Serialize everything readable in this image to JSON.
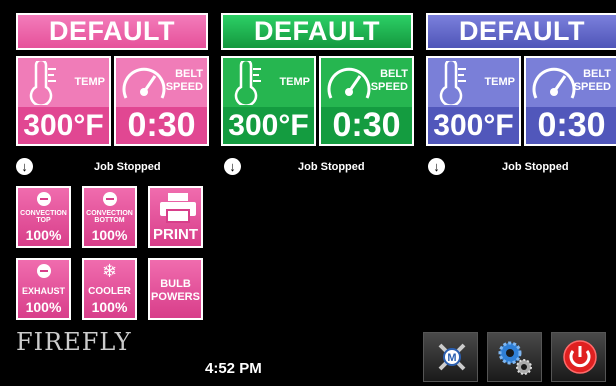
{
  "colors": {
    "pink": "#ef66a8",
    "green": "#1ea84a",
    "blue": "#6167c8",
    "bg": "#000000"
  },
  "lanes": [
    {
      "title": "DEFAULT",
      "temp_label": "TEMP",
      "belt_label_1": "BELT",
      "belt_label_2": "SPEED",
      "temp_value": "300°F",
      "time_value": "0:30",
      "status": "Job Stopped"
    },
    {
      "title": "DEFAULT",
      "temp_label": "TEMP",
      "belt_label_1": "BELT",
      "belt_label_2": "SPEED",
      "temp_value": "300°F",
      "time_value": "0:30",
      "status": "Job Stopped"
    },
    {
      "title": "DEFAULT",
      "temp_label": "TEMP",
      "belt_label_1": "BELT",
      "belt_label_2": "SPEED",
      "temp_value": "300°F",
      "time_value": "0:30",
      "status": "Job Stopped"
    }
  ],
  "controls": {
    "conv_top_1": "CONVECTION",
    "conv_top_2": "TOP",
    "conv_top_value": "100%",
    "conv_bottom_1": "CONVECTION",
    "conv_bottom_2": "BOTTOM",
    "conv_bottom_value": "100%",
    "print_label": "PRINT",
    "exhaust_label": "EXHAUST",
    "exhaust_value": "100%",
    "cooler_label": "COOLER",
    "cooler_value": "100%",
    "bulb_1": "BULB",
    "bulb_2": "POWERS"
  },
  "footer": {
    "logo": "FIREFLY",
    "clock": "4:52 PM"
  },
  "icons": {
    "service": "wrench-m-icon",
    "settings": "gears-icon",
    "power": "power-icon"
  }
}
